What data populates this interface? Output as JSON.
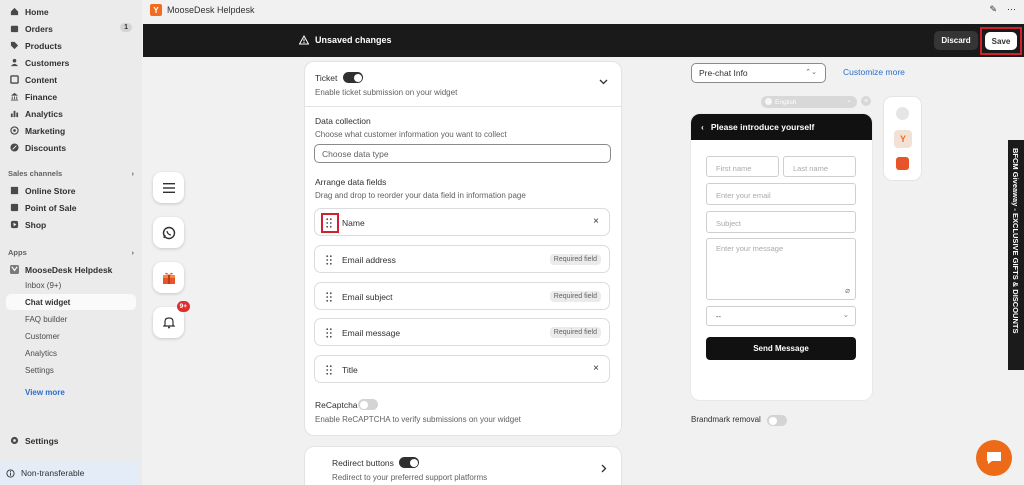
{
  "app": {
    "title": "MooseDesk Helpdesk"
  },
  "sidebar": {
    "items": [
      {
        "label": "Home",
        "icon": "home-icon"
      },
      {
        "label": "Orders",
        "icon": "orders-icon",
        "badge": "1"
      },
      {
        "label": "Products",
        "icon": "tag-icon"
      },
      {
        "label": "Customers",
        "icon": "person-icon"
      },
      {
        "label": "Content",
        "icon": "content-icon"
      },
      {
        "label": "Finance",
        "icon": "bank-icon"
      },
      {
        "label": "Analytics",
        "icon": "chart-icon"
      },
      {
        "label": "Marketing",
        "icon": "target-icon"
      },
      {
        "label": "Discounts",
        "icon": "discount-icon"
      }
    ],
    "sales_channels_title": "Sales channels",
    "sales_channels": [
      {
        "label": "Online Store",
        "icon": "store-icon"
      },
      {
        "label": "Point of Sale",
        "icon": "pos-icon"
      },
      {
        "label": "Shop",
        "icon": "shop-icon"
      }
    ],
    "apps_title": "Apps",
    "app_name": "MooseDesk Helpdesk",
    "app_subitems": [
      "Inbox (9+)",
      "Chat widget",
      "FAQ builder",
      "Customer",
      "Analytics",
      "Settings"
    ],
    "view_more": "View more",
    "settings": "Settings",
    "non_transferable": "Non-transferable"
  },
  "save_bar": {
    "message": "Unsaved changes",
    "discard": "Discard",
    "save": "Save"
  },
  "launchers": {
    "notification_badge": "9+"
  },
  "ticket": {
    "title": "Ticket",
    "description": "Enable ticket submission on your widget",
    "enabled": true
  },
  "data_collection": {
    "title": "Data collection",
    "description": "Choose what customer information you want to collect",
    "placeholder": "Choose data type"
  },
  "arrange": {
    "title": "Arrange data fields",
    "description": "Drag and drop to reorder your data field in information page",
    "fields": [
      {
        "name": "Name",
        "required": "",
        "removable": true
      },
      {
        "name": "Email address",
        "required": "Required field",
        "removable": false
      },
      {
        "name": "Email subject",
        "required": "Required field",
        "removable": false
      },
      {
        "name": "Email message",
        "required": "Required field",
        "removable": false
      },
      {
        "name": "Title",
        "required": "",
        "removable": true
      }
    ]
  },
  "recaptcha": {
    "title": "ReCaptcha",
    "description": "Enable ReCAPTCHA to verify submissions on your widget",
    "enabled": false
  },
  "redirect": {
    "title": "Redirect buttons",
    "description": "Redirect to your preferred support platforms",
    "enabled": true
  },
  "preview": {
    "view_select": "Pre-chat Info",
    "customize_link": "Customize more",
    "language": "English",
    "header": "Please introduce yourself",
    "first_name": "First name",
    "last_name": "Last name",
    "email": "Enter your email",
    "subject": "Subject",
    "message": "Enter your message",
    "dropdown": "--",
    "send_button": "Send Message",
    "brandmark": "Brandmark removal"
  },
  "banner": {
    "text": "BFCM Giveaway - EXCLUSIVE GIFTS & DISCOUNTS"
  },
  "colors": {
    "accent": "#303030",
    "highlight": "#d1202f",
    "brand": "#f26b21",
    "link": "#2c6ecb"
  }
}
